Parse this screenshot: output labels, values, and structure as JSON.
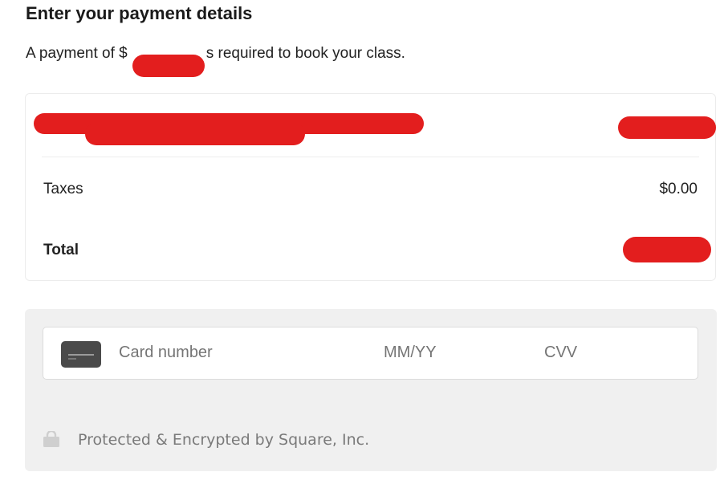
{
  "header": {
    "title": "Enter your payment details",
    "subtitle_prefix": "A payment of $",
    "subtitle_suffix": "s required to book your class."
  },
  "summary": {
    "taxes_label": "Taxes",
    "taxes_value": "$0.00",
    "total_label": "Total"
  },
  "card_form": {
    "card_number_placeholder": "Card number",
    "expiry_placeholder": "MM/YY",
    "cvv_placeholder": "CVV"
  },
  "security": {
    "icon": "lock-icon",
    "text": "Protected & Encrypted by Square, Inc."
  },
  "colors": {
    "redaction": "#e31e1e",
    "panel_bg": "#f0f0f0",
    "card_icon": "#4a4a4a"
  }
}
